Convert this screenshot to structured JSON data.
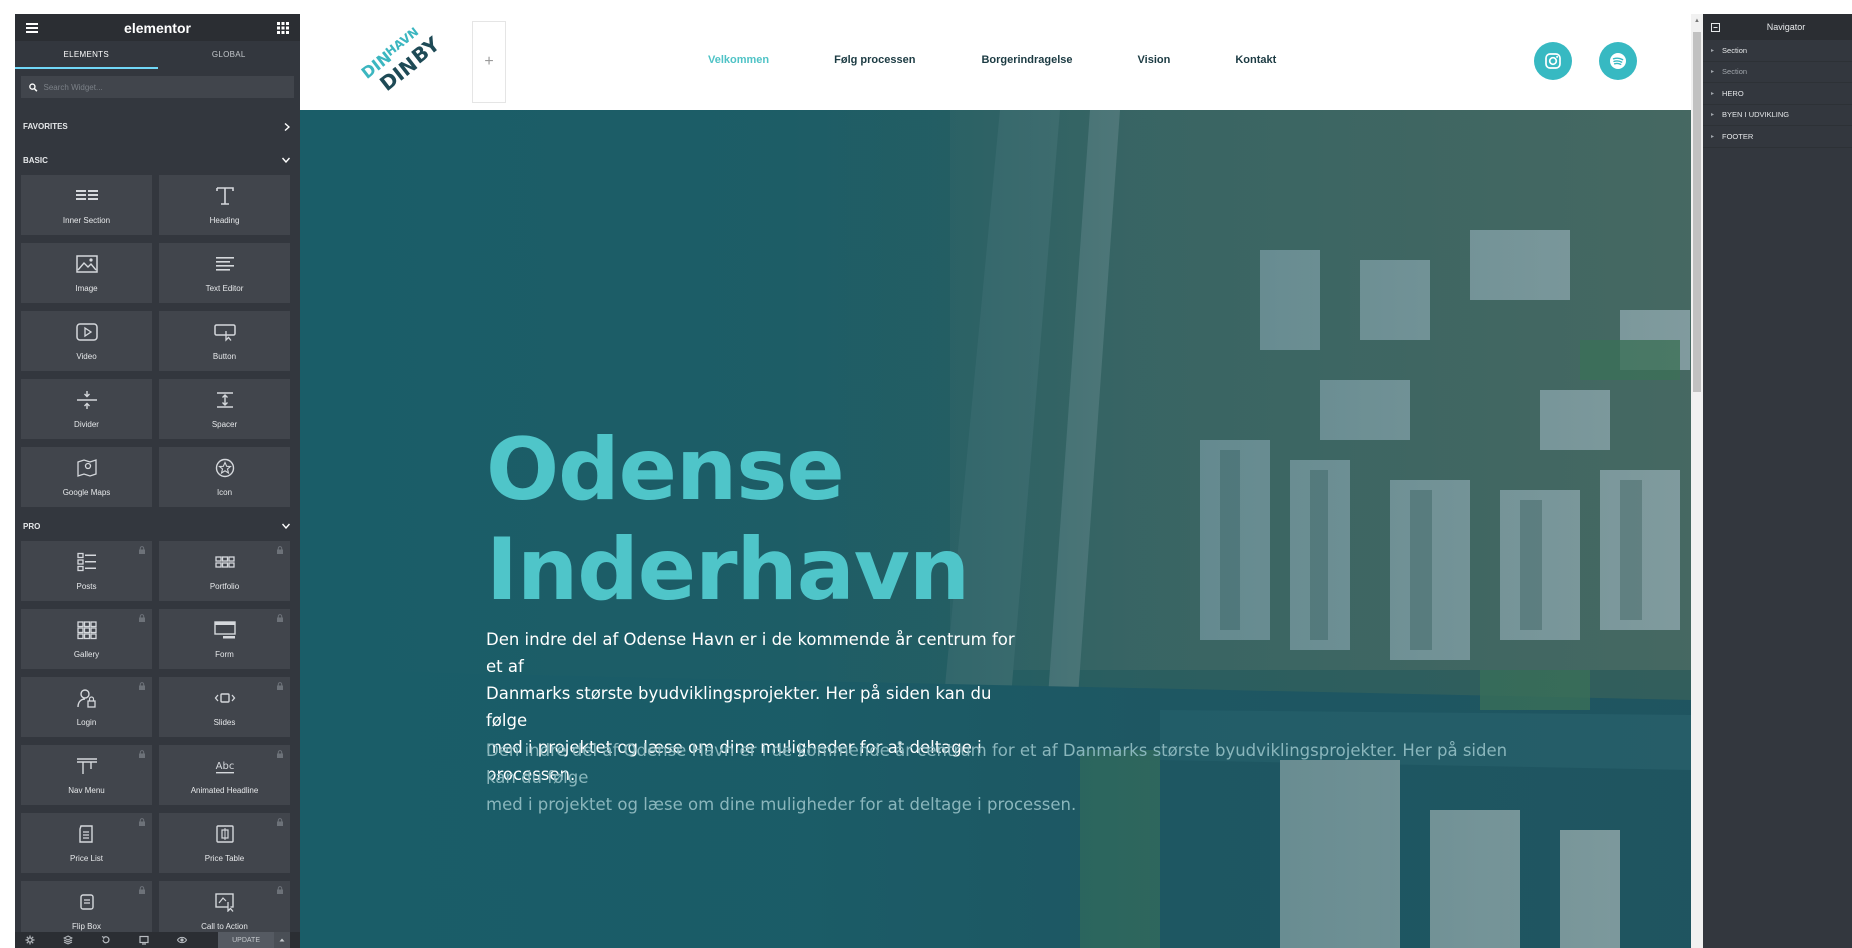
{
  "elementor_panel": {
    "brand": "elementor",
    "tabs": [
      {
        "label": "ELEMENTS",
        "active": true
      },
      {
        "label": "GLOBAL",
        "active": false
      }
    ],
    "search_placeholder": "Search Widget...",
    "categories": {
      "favorites": "FAVORITES",
      "basic": "BASIC",
      "pro": "PRO"
    },
    "basic_widgets": [
      "Inner Section",
      "Heading",
      "Image",
      "Text Editor",
      "Video",
      "Button",
      "Divider",
      "Spacer",
      "Google Maps",
      "Icon"
    ],
    "pro_widgets": [
      "Posts",
      "Portfolio",
      "Gallery",
      "Form",
      "Login",
      "Slides",
      "Nav Menu",
      "Animated Headline",
      "Price List",
      "Price Table",
      "Flip Box",
      "Call to Action"
    ],
    "update_label": "UPDATE"
  },
  "site": {
    "add_symbol": "+",
    "nav": [
      {
        "label": "Velkommen",
        "active": true
      },
      {
        "label": "Følg processen",
        "active": false
      },
      {
        "label": "Borgerindragelse",
        "active": false
      },
      {
        "label": "Vision",
        "active": false
      },
      {
        "label": "Kontakt",
        "active": false
      }
    ],
    "social_icons": [
      "instagram-icon",
      "spotify-icon"
    ],
    "accent_color": "#4fc5c9",
    "hero": {
      "title_line1": "Odense",
      "title_line2": "Inderhavn",
      "lead_lines": [
        "Den indre del af Odense Havn er i de kommende år centrum for et af",
        "Danmarks største byudviklingsprojekter. Her på siden kan du følge",
        "med i projektet og læse om dine muligheder for at deltage i processen."
      ],
      "secondary_lines": [
        "Den indre del af Odense Havn er i de kommende år centrum for et af Danmarks største byudviklingsprojekter. Her på siden kan du følge",
        "med i projektet og læse om dine muligheder for at deltage i processen."
      ]
    }
  },
  "navigator": {
    "title": "Navigator",
    "items": [
      {
        "label": "Section",
        "dim": false
      },
      {
        "label": "Section",
        "dim": true
      },
      {
        "label": "HERO",
        "dim": false
      },
      {
        "label": "BYEN I UDVIKLING",
        "dim": false
      },
      {
        "label": "FOOTER",
        "dim": false
      }
    ]
  }
}
